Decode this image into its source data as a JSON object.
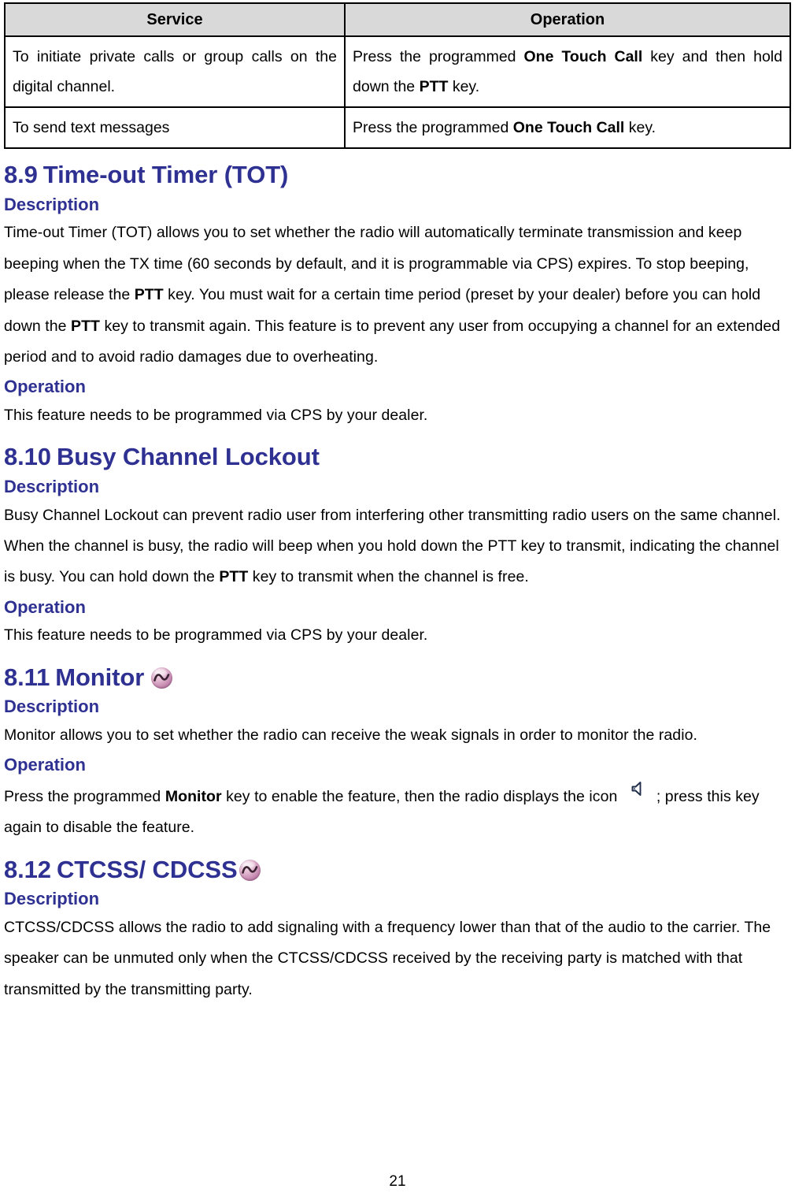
{
  "document": {
    "page_number": "21",
    "heading_color": "#2F3192",
    "table_header_bg": "#D9D9D9"
  },
  "table": {
    "headers": [
      "Service",
      "Operation"
    ],
    "rows": [
      {
        "service": "To initiate private calls or group calls on the digital channel.",
        "operation_pre": "Press the programmed ",
        "operation_bold1": "One Touch Call",
        "operation_mid": " key and then hold down the ",
        "operation_bold2": "PTT",
        "operation_post": " key."
      },
      {
        "service": "To send text messages",
        "operation_pre": "Press the programmed ",
        "operation_bold1": "One Touch Call",
        "operation_post": " key."
      }
    ]
  },
  "sections": [
    {
      "number": "8.9",
      "title": "Time-out Timer (TOT)",
      "icon": null,
      "description_label": "Description",
      "description_parts": {
        "p1": "Time-out Timer (TOT) allows you to set whether the radio will automatically terminate transmission and keep beeping when the TX time (60 seconds by default, and it is programmable via CPS) expires. To stop beeping, please release the ",
        "b1": "PTT",
        "p2": " key. You must wait for a certain time period (preset by your dealer) before you can hold down the ",
        "b2": "PTT",
        "p3": " key to transmit again. This feature is to prevent any user from occupying a channel for an extended period and to avoid radio damages due to overheating."
      },
      "operation_label": "Operation",
      "operation_text": "This feature needs to be programmed via CPS by your dealer."
    },
    {
      "number": "8.10",
      "title": "Busy Channel Lockout",
      "icon": null,
      "description_label": "Description",
      "description_parts": {
        "p1": "Busy Channel Lockout can prevent radio user from interfering other transmitting radio users on the same channel. When the channel is busy, the radio will beep when you hold down the PTT key to transmit, indicating the channel is busy. You can hold down the ",
        "b1": "PTT",
        "p2": " key to transmit when the channel is free."
      },
      "operation_label": "Operation",
      "operation_text": "This feature needs to be programmed via CPS by your dealer."
    },
    {
      "number": "8.11",
      "title": "Monitor",
      "icon": "wave-circle-icon",
      "description_label": "Description",
      "description_parts": {
        "p1": "Monitor allows you to set whether the radio can receive the weak signals in order to monitor the radio."
      },
      "operation_label": "Operation",
      "operation_parts": {
        "p1": "Press the programmed ",
        "b1": "Monitor",
        "p2": " key to enable the feature, then the radio displays the icon ",
        "icon": "speaker-icon",
        "p3": "; press this key again to disable the feature."
      }
    },
    {
      "number": "8.12",
      "title": "CTCSS/ CDCSS",
      "icon": "wave-circle-icon",
      "description_label": "Description",
      "description_parts": {
        "p1": "CTCSS/CDCSS allows the radio to add signaling with a frequency lower than that of the audio to the carrier. The speaker can be unmuted only when the CTCSS/CDCSS received by the receiving party is matched with that transmitted by the transmitting party."
      }
    }
  ]
}
